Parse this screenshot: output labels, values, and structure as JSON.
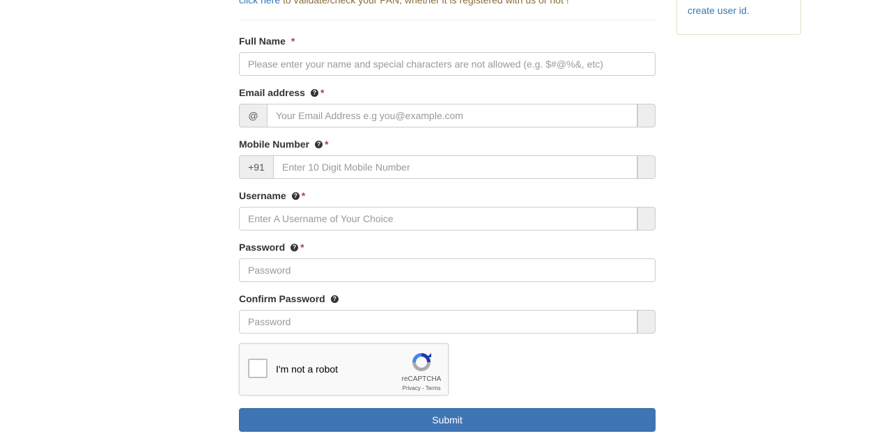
{
  "top_note": {
    "link_text": "click here",
    "rest_text": " to validate/check your PAN, whether it is registered with us or not !"
  },
  "side_panel": {
    "link_text": "create user id."
  },
  "form": {
    "full_name": {
      "label": "Full Name",
      "required": "*",
      "placeholder": "Please enter your name and special characters are not allowed (e.g. $#@%&, etc)",
      "value": ""
    },
    "email": {
      "label": "Email address",
      "required": "*",
      "addon": "@",
      "placeholder": "Your Email Address e.g you@example.com",
      "value": "",
      "help_icon": "question-circle-icon"
    },
    "mobile": {
      "label": "Mobile Number",
      "required": "*",
      "addon": "+91",
      "placeholder": "Enter 10 Digit Mobile Number",
      "value": "",
      "help_icon": "question-circle-icon"
    },
    "username": {
      "label": "Username",
      "required": "*",
      "placeholder": "Enter A Username of Your Choice",
      "value": "",
      "help_icon": "question-circle-icon"
    },
    "password": {
      "label": "Password",
      "required": "*",
      "placeholder": "Password",
      "value": "",
      "help_icon": "question-circle-icon"
    },
    "confirm_password": {
      "label": "Confirm Password",
      "placeholder": "Password",
      "value": "",
      "help_icon": "question-circle-icon"
    }
  },
  "captcha": {
    "label": "I'm not a robot",
    "brand": "reCAPTCHA",
    "links": "Privacy - Terms",
    "checked": false
  },
  "submit": {
    "label": "Submit"
  },
  "help_glyph": "?",
  "colors": {
    "primary": "#3f74b5",
    "link": "#337ab7",
    "required": "#a94442",
    "warning_text": "#8a6d3b"
  }
}
